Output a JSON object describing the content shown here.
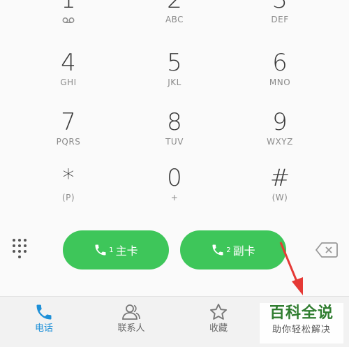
{
  "dialpad": {
    "keys": [
      {
        "digit": "1",
        "sub": ""
      },
      {
        "digit": "2",
        "sub": "ABC"
      },
      {
        "digit": "3",
        "sub": "DEF"
      },
      {
        "digit": "4",
        "sub": "GHI"
      },
      {
        "digit": "5",
        "sub": "JKL"
      },
      {
        "digit": "6",
        "sub": "MNO"
      },
      {
        "digit": "7",
        "sub": "PQRS"
      },
      {
        "digit": "8",
        "sub": "TUV"
      },
      {
        "digit": "9",
        "sub": "WXYZ"
      },
      {
        "digit": "*",
        "sub": "(P)"
      },
      {
        "digit": "0",
        "sub": "+"
      },
      {
        "digit": "#",
        "sub": "(W)"
      }
    ]
  },
  "actions": {
    "call_sim1": {
      "num": "1",
      "label": "主卡"
    },
    "call_sim2": {
      "num": "2",
      "label": "副卡"
    }
  },
  "tabs": [
    {
      "label": "电话",
      "icon": "phone-icon",
      "active": true
    },
    {
      "label": "联系人",
      "icon": "contacts-icon",
      "active": false
    },
    {
      "label": "收藏",
      "icon": "star-icon",
      "active": false
    }
  ],
  "watermark": {
    "line1": "百科全说",
    "line2": "助你轻松解决"
  },
  "colors": {
    "call_green": "#3ec65a",
    "active_tab": "#1e90d8",
    "arrow_red": "#e53935"
  }
}
